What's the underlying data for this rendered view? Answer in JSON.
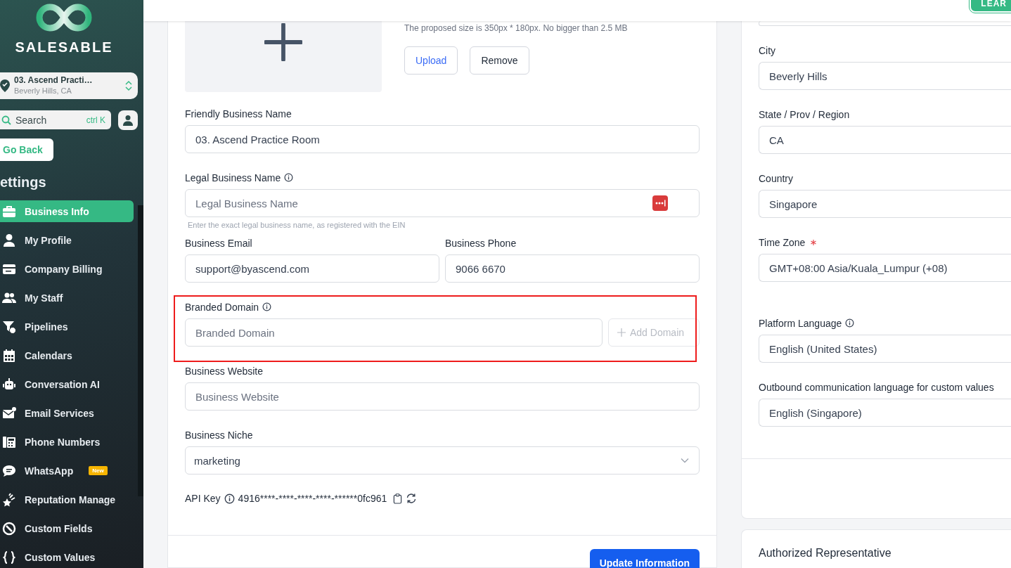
{
  "sidebar": {
    "logo_text": "SALESABLE",
    "location": {
      "name": "03. Ascend Practi…",
      "address": "Beverly Hills, CA"
    },
    "search": {
      "placeholder": "Search",
      "shortcut": "ctrl K"
    },
    "back_button": "Go Back",
    "section_title": "ettings",
    "items": [
      {
        "label": "Business Info",
        "selected": true
      },
      {
        "label": "My Profile",
        "selected": false
      },
      {
        "label": "Company Billing",
        "selected": false
      },
      {
        "label": "My Staff",
        "selected": false
      },
      {
        "label": "Pipelines",
        "selected": false
      },
      {
        "label": "Calendars",
        "selected": false
      },
      {
        "label": "Conversation AI",
        "selected": false
      },
      {
        "label": "Email Services",
        "selected": false
      },
      {
        "label": "Phone Numbers",
        "selected": false
      },
      {
        "label": "WhatsApp",
        "selected": false,
        "badge": "New"
      },
      {
        "label": "Reputation Manage",
        "selected": false
      },
      {
        "label": "Custom Fields",
        "selected": false
      },
      {
        "label": "Custom Values",
        "selected": false
      }
    ]
  },
  "header": {
    "button": "LEAR"
  },
  "business_card": {
    "logo_upload": {
      "hint": "The proposed size is 350px * 180px. No bigger than 2.5 MB",
      "buttons": [
        {
          "label": "Upload",
          "kind": "primary"
        },
        {
          "label": "Remove",
          "kind": "plain"
        }
      ]
    },
    "rows": [
      [
        {
          "kind": "text",
          "label": "Friendly Business Name",
          "value": "03. Ascend Practice Room"
        }
      ],
      [
        {
          "kind": "text",
          "label": "Legal Business Name",
          "info": true,
          "placeholder": "Legal Business Name",
          "password_icon": true,
          "helper": "Enter the exact legal business name, as registered with the EIN"
        }
      ],
      [
        {
          "kind": "text",
          "label": "Business Email",
          "value": "support@byascend.com"
        },
        {
          "kind": "text",
          "label": "Business Phone",
          "value": "9066 6670"
        }
      ],
      [
        {
          "kind": "text",
          "label": "Branded Domain",
          "info": true,
          "placeholder": "Branded Domain",
          "highlighted": true,
          "action": {
            "label": "Add Domain",
            "disabled": true
          }
        }
      ],
      [
        {
          "kind": "text",
          "label": "Business Website",
          "placeholder": "Business Website"
        }
      ],
      [
        {
          "kind": "select",
          "label": "Business Niche",
          "value": "marketing"
        }
      ]
    ],
    "api_key": {
      "label": "API Key",
      "value": "4916****-****-****-****-******0fc961"
    },
    "submit": "Update Information"
  },
  "address_card": {
    "groups": [
      [
        {
          "kind": "text"
        },
        {
          "kind": "text",
          "label": "City",
          "value": "Beverly Hills"
        },
        {
          "kind": "text",
          "label": "State / Prov / Region",
          "value": "CA"
        },
        {
          "kind": "text",
          "label": "Country",
          "value": "Singapore"
        },
        {
          "kind": "text",
          "label": "Time Zone",
          "required": true,
          "value": "GMT+08:00 Asia/Kuala_Lumpur (+08)"
        }
      ],
      [
        {
          "kind": "text",
          "label": "Platform Language",
          "info": true,
          "value": "English (United States)"
        },
        {
          "kind": "text",
          "label": "Outbound communication language for custom values",
          "value": "English (Singapore)"
        }
      ]
    ]
  },
  "representative_card": {
    "title": "Authorized Representative"
  }
}
